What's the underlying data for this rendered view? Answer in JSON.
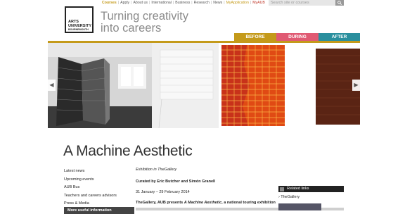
{
  "topnav": {
    "items": [
      "Courses",
      "Apply",
      "About us",
      "International",
      "Business",
      "Research",
      "News",
      "MyApplication",
      "MyAUB"
    ],
    "search_placeholder": "Search site or courses"
  },
  "logo": {
    "line1": "ARTS",
    "line2": "UNIVERSITY",
    "line3": "BOURNEMOUTH"
  },
  "tagline": {
    "line1": "Turning creativity",
    "line2": "into careers"
  },
  "tabs": {
    "before": "BEFORE",
    "during": "DURING",
    "after": "AFTER"
  },
  "carousel": {
    "prev": "◀",
    "next": "▶"
  },
  "page_title": "A Machine Aesthetic",
  "left_nav": {
    "items": [
      "Latest news",
      "Upcoming events",
      "AUB Bus",
      "Teachers and careers advisors",
      "Press & Media"
    ],
    "section_header": "More useful information"
  },
  "article": {
    "category": "Exhibition in TheGallery",
    "curated": "Curated by Eric Butcher and Simón Granell",
    "dates": "31 January – 29 February 2014",
    "lead_bold": "TheGallery, AUB presents ",
    "lead_italic": "A Machine Aesthetic",
    "lead_rest": ", a national touring exhibition"
  },
  "related": {
    "header": "Related links",
    "items": [
      "TheGallery"
    ]
  },
  "colors": {
    "before": "#c49a1a",
    "during": "#e05a73",
    "after": "#2a8f9e"
  }
}
